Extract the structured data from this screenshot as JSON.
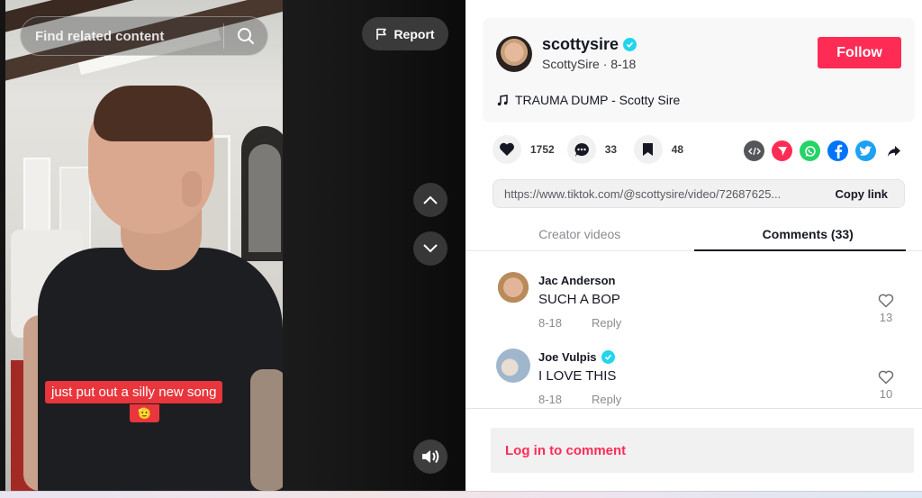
{
  "video": {
    "search_placeholder": "Find related content",
    "report_label": "Report",
    "caption_text": "just put out a silly new song",
    "caption_emoji": "🫡"
  },
  "author": {
    "username": "scottysire",
    "display_name": "ScottySire",
    "date": "8-18",
    "sub_line": "ScottySire · 8-18",
    "verified": true,
    "follow_label": "Follow",
    "music": "TRAUMA DUMP - Scotty Sire"
  },
  "actions": {
    "likes": "1752",
    "comments": "33",
    "saves": "48"
  },
  "share": {
    "icons": [
      "embed-icon",
      "send-icon",
      "whatsapp-icon",
      "facebook-icon",
      "twitter-icon",
      "share-arrow-icon"
    ],
    "colors": {
      "embed": "#555659",
      "send": "#fe2c55",
      "whatsapp": "#25d366",
      "facebook": "#0075fa",
      "twitter": "#1da1f2"
    }
  },
  "link": {
    "url": "https://www.tiktok.com/@scottysire/video/72687625...",
    "copy_label": "Copy link"
  },
  "tabs": [
    {
      "label": "Creator videos",
      "active": false
    },
    {
      "label": "Comments (33)",
      "active": true
    }
  ],
  "comments": [
    {
      "name": "Jac Anderson",
      "verified": false,
      "text": "SUCH A BOP",
      "date": "8-18",
      "reply_label": "Reply",
      "likes": "13"
    },
    {
      "name": "Joe Vulpis",
      "verified": true,
      "text": "I LOVE THIS",
      "date": "8-18",
      "reply_label": "Reply",
      "likes": "10"
    }
  ],
  "login_prompt": "Log in to comment",
  "colors": {
    "accent": "#fe2c55",
    "verified": "#20d5ec",
    "caption_bg": "#e8363c"
  }
}
